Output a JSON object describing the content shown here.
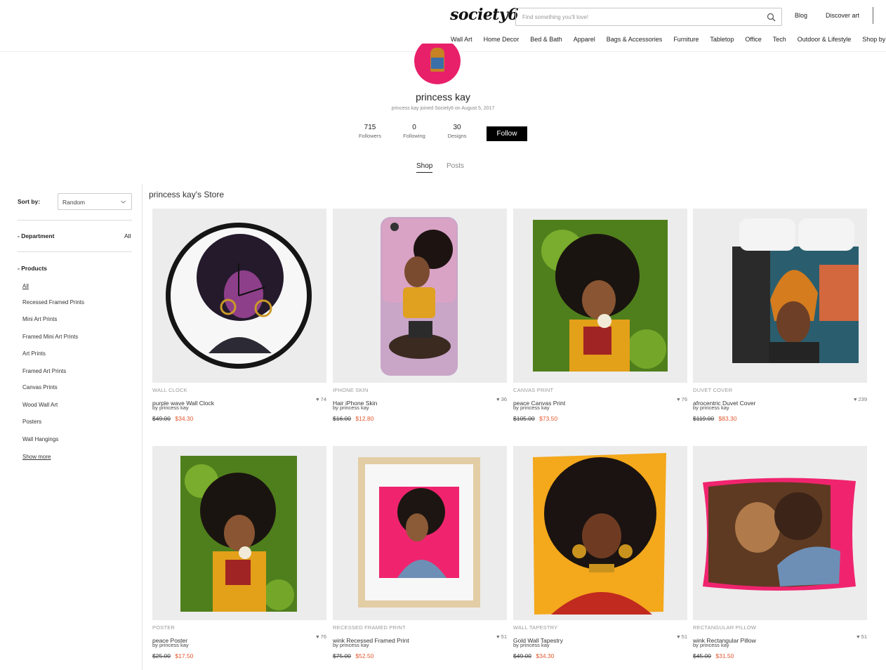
{
  "header": {
    "logo": "society6",
    "search_placeholder": "Find something you'll love!",
    "links": [
      "Blog",
      "Discover art"
    ],
    "nav": [
      "Wall Art",
      "Home Decor",
      "Bed & Bath",
      "Apparel",
      "Bags & Accessories",
      "Furniture",
      "Tabletop",
      "Office",
      "Tech",
      "Outdoor & Lifestyle",
      "Shop by"
    ]
  },
  "profile": {
    "name": "princess kay",
    "joined": "princess kay joined Society6 on August 5, 2017",
    "stats": [
      {
        "num": "715",
        "label": "Followers"
      },
      {
        "num": "0",
        "label": "Following"
      },
      {
        "num": "30",
        "label": "Designs"
      }
    ],
    "follow_label": "Follow",
    "tabs": [
      "Shop",
      "Posts"
    ]
  },
  "sidebar": {
    "sort_label": "Sort by:",
    "sort_value": "Random",
    "department_label": "- Department",
    "department_value": "All",
    "products_label": "- Products",
    "products": [
      "All",
      "Recessed Framed Prints",
      "Mini Art Prints",
      "Framed Mini Art Prints",
      "Art Prints",
      "Framed Art Prints",
      "Canvas Prints",
      "Wood Wall Art",
      "Posters",
      "Wall Hangings"
    ],
    "show_more": "Show more"
  },
  "store": {
    "title": "princess kay's Store",
    "products": [
      {
        "type": "WALL CLOCK",
        "title": "purple wave Wall Clock",
        "by": "by princess kay",
        "likes": "74",
        "old_price": "$49.00",
        "new_price": "$34.30"
      },
      {
        "type": "IPHONE SKIN",
        "title": "Hair iPhone Skin",
        "by": "by princess kay",
        "likes": "36",
        "old_price": "$16.00",
        "new_price": "$12.80"
      },
      {
        "type": "CANVAS PRINT",
        "title": "peace Canvas Print",
        "by": "by princess kay",
        "likes": "76",
        "old_price": "$105.00",
        "new_price": "$73.50"
      },
      {
        "type": "DUVET COVER",
        "title": "afrocentric Duvet Cover",
        "by": "by princess kay",
        "likes": "239",
        "old_price": "$119.00",
        "new_price": "$83.30"
      },
      {
        "type": "POSTER",
        "title": "peace Poster",
        "by": "by princess kay",
        "likes": "76",
        "old_price": "$25.00",
        "new_price": "$17.50"
      },
      {
        "type": "RECESSED FRAMED PRINT",
        "title": "wink Recessed Framed Print",
        "by": "by princess kay",
        "likes": "51",
        "old_price": "$75.00",
        "new_price": "$52.50"
      },
      {
        "type": "WALL TAPESTRY",
        "title": "Gold Wall Tapestry",
        "by": "by princess kay",
        "likes": "51",
        "old_price": "$49.00",
        "new_price": "$34.30"
      },
      {
        "type": "RECTANGULAR PILLOW",
        "title": "wink Rectangular Pillow",
        "by": "by princess kay",
        "likes": "51",
        "old_price": "$45.00",
        "new_price": "$31.50"
      }
    ]
  }
}
